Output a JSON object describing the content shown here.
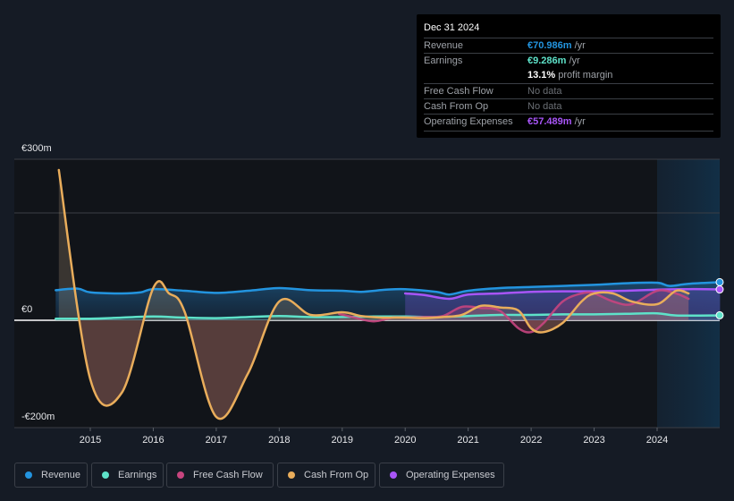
{
  "tooltip": {
    "date": "Dec 31 2024",
    "rows": [
      {
        "label": "Revenue",
        "value": "€70.986m",
        "suffix": " /yr",
        "color": "#2394df"
      },
      {
        "label": "Earnings",
        "value": "€9.286m",
        "suffix": " /yr",
        "color": "#5ee2c9"
      },
      {
        "label": "",
        "value": "13.1%",
        "suffix": " profit margin",
        "color": "#ffffff"
      },
      {
        "label": "Free Cash Flow",
        "value": "No data",
        "suffix": "",
        "color": "#6b6f75"
      },
      {
        "label": "Cash From Op",
        "value": "No data",
        "suffix": "",
        "color": "#6b6f75"
      },
      {
        "label": "Operating Expenses",
        "value": "€57.489m",
        "suffix": " /yr",
        "color": "#a855f7"
      }
    ]
  },
  "legend": [
    {
      "label": "Revenue",
      "color": "#2394df"
    },
    {
      "label": "Earnings",
      "color": "#5ee2c9"
    },
    {
      "label": "Free Cash Flow",
      "color": "#c7457f"
    },
    {
      "label": "Cash From Op",
      "color": "#e9ad5b"
    },
    {
      "label": "Operating Expenses",
      "color": "#a855f7"
    }
  ],
  "chart_data": {
    "type": "area",
    "title": "",
    "xlabel": "",
    "ylabel": "",
    "ylim": [
      -200,
      300
    ],
    "xlim": [
      2014.3,
      2025.0
    ],
    "y_tick_labels": [
      {
        "value": 300,
        "label": "€300m"
      },
      {
        "value": 0,
        "label": "€0"
      },
      {
        "value": -200,
        "label": "-€200m"
      }
    ],
    "gridlines": [
      300,
      200,
      0,
      -200
    ],
    "x_ticks": [
      2015,
      2016,
      2017,
      2018,
      2019,
      2020,
      2021,
      2022,
      2023,
      2024
    ],
    "forecast_shade_from": 2024.0,
    "series": [
      {
        "name": "Revenue",
        "color": "#2394df",
        "x": [
          2014.45,
          2014.8,
          2015.0,
          2015.5,
          2015.8,
          2016.0,
          2016.5,
          2017.0,
          2017.5,
          2018.0,
          2018.5,
          2019.0,
          2019.3,
          2019.7,
          2020.0,
          2020.5,
          2020.7,
          2021.0,
          2021.5,
          2022.0,
          2022.5,
          2023.0,
          2023.5,
          2024.0,
          2024.2,
          2024.5,
          2025.0
        ],
        "values": [
          56,
          59,
          52,
          50,
          52,
          58,
          55,
          51,
          55,
          60,
          56,
          55,
          53,
          57,
          58,
          53,
          48,
          55,
          60,
          62,
          64,
          66,
          69,
          70,
          64,
          68,
          71
        ]
      },
      {
        "name": "Earnings",
        "color": "#5ee2c9",
        "x": [
          2014.45,
          2015.0,
          2015.5,
          2016.0,
          2016.5,
          2017.0,
          2017.5,
          2018.0,
          2018.5,
          2019.0,
          2019.5,
          2020.0,
          2020.5,
          2021.0,
          2021.5,
          2022.0,
          2022.5,
          2023.0,
          2023.5,
          2024.0,
          2024.3,
          2025.0
        ],
        "values": [
          3,
          3,
          5,
          7,
          5,
          4,
          6,
          8,
          6,
          6,
          7,
          7,
          6,
          8,
          10,
          10,
          11,
          11,
          12,
          13,
          9,
          9
        ]
      },
      {
        "name": "Free Cash Flow",
        "color": "#c7457f",
        "x": [
          2018.95,
          2019.2,
          2019.5,
          2019.8,
          2020.0,
          2020.3,
          2020.6,
          2020.9,
          2021.2,
          2021.5,
          2021.8,
          2022.0,
          2022.2,
          2022.5,
          2022.8,
          2023.0,
          2023.3,
          2023.6,
          2024.0,
          2024.3,
          2024.5
        ],
        "values": [
          12,
          5,
          -2,
          5,
          5,
          6,
          8,
          25,
          23,
          18,
          -15,
          -22,
          -5,
          35,
          50,
          50,
          35,
          30,
          55,
          50,
          40
        ]
      },
      {
        "name": "Cash From Op",
        "color": "#e9ad5b",
        "x": [
          2014.5,
          2015.0,
          2015.5,
          2016.0,
          2016.25,
          2016.5,
          2017.0,
          2017.5,
          2018.0,
          2018.5,
          2019.0,
          2019.3,
          2019.6,
          2020.0,
          2020.3,
          2020.6,
          2020.9,
          2021.2,
          2021.5,
          2021.8,
          2022.0,
          2022.2,
          2022.5,
          2022.8,
          2023.0,
          2023.3,
          2023.6,
          2024.0,
          2024.3,
          2024.5
        ],
        "values": [
          280,
          -110,
          -135,
          60,
          50,
          15,
          -180,
          -100,
          35,
          10,
          15,
          8,
          5,
          5,
          4,
          6,
          10,
          27,
          24,
          18,
          -15,
          -22,
          -5,
          35,
          50,
          50,
          35,
          30,
          55,
          50
        ]
      },
      {
        "name": "Operating Expenses",
        "color": "#a855f7",
        "x": [
          2020.0,
          2020.3,
          2020.7,
          2021.0,
          2021.5,
          2022.0,
          2022.5,
          2023.0,
          2023.5,
          2024.0,
          2024.5,
          2025.0
        ],
        "values": [
          50,
          47,
          40,
          48,
          50,
          53,
          54,
          54,
          55,
          57,
          58,
          57.5
        ]
      }
    ]
  }
}
